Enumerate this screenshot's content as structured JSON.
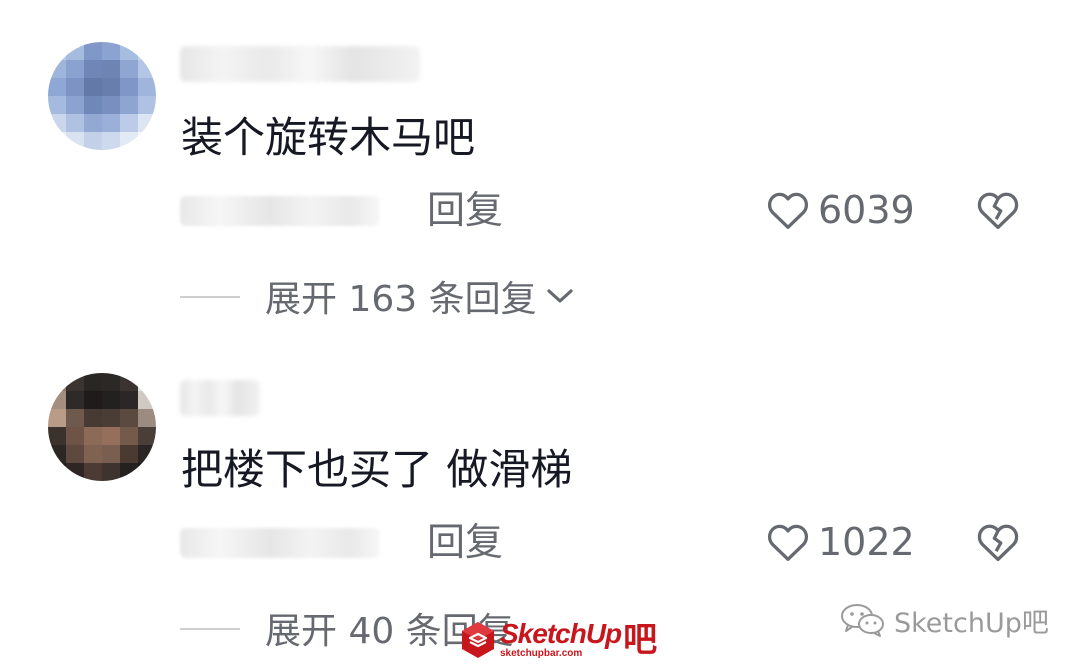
{
  "comments": [
    {
      "text": "装个旋转木马吧",
      "reply_label": "回复",
      "like_count": "6039",
      "expand_label": "展开 163 条回复"
    },
    {
      "text": "把楼下也买了 做滑梯",
      "reply_label": "回复",
      "like_count": "1022",
      "expand_label": "展开 40 条回复"
    }
  ],
  "icons": {
    "like": "heart-outline-icon",
    "dislike": "broken-heart-icon",
    "expand": "chevron-down-icon"
  },
  "watermark": {
    "brand_name": "SketchUp",
    "brand_suffix": "吧",
    "brand_url": "sketchupbar.com",
    "wechat_label": "SketchUp吧"
  },
  "colors": {
    "primary_text": "#161823",
    "secondary_text": "#666a70",
    "brand_red": "#c8161d"
  }
}
